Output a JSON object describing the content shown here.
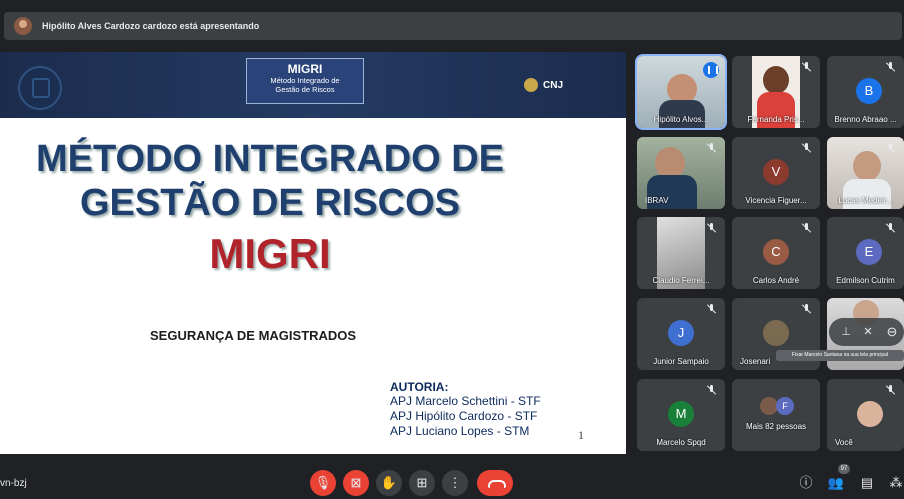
{
  "presenting_banner": "Hipólito Alves Cardozo cardozo está apresentando",
  "slide": {
    "box_title": "MIGRI",
    "box_subtitle_line1": "Método Integrado de",
    "box_subtitle_line2": "Gestão de Riscos",
    "logo_text": "CNJ",
    "title_line1": "MÉTODO INTEGRADO DE",
    "title_line2": "GESTÃO DE RISCOS",
    "title_line3": "MIGRI",
    "subtitle": "SEGURANÇA DE MAGISTRADOS",
    "autoria_label": "AUTORIA:",
    "authors": [
      "APJ Marcelo Schettini - STF",
      "APJ Hipólito Cardozo - STF",
      "APJ Luciano Lopes - STM"
    ],
    "page_number": "1"
  },
  "participants": [
    {
      "name": "Hipólito Alvos...",
      "type": "video",
      "speaking": true
    },
    {
      "name": "Fernanda Pris...",
      "type": "video"
    },
    {
      "name": "Brenno Abraao ...",
      "type": "avatar",
      "initial": "B",
      "color": "#1a73e8"
    },
    {
      "name": "IBRAV",
      "type": "video"
    },
    {
      "name": "Vicencia Figuer...",
      "type": "avatar",
      "initial": "V",
      "color": "#8b3a2e"
    },
    {
      "name": "Lucas Medeir...",
      "type": "video"
    },
    {
      "name": "Claudio Ferrei...",
      "type": "video"
    },
    {
      "name": "Carlos André",
      "type": "avatar",
      "initial": "C",
      "color": "#9a5b44"
    },
    {
      "name": "Edmilson Cutrim",
      "type": "avatar",
      "initial": "E",
      "color": "#5c6bc0"
    },
    {
      "name": "Junior Sampaio",
      "type": "avatar",
      "initial": "J",
      "color": "#3f6fd1"
    },
    {
      "name": "Josenari",
      "type": "video"
    },
    {
      "name": "Marcelo Santana",
      "type": "video"
    },
    {
      "name": "Marcelo Spqd",
      "type": "avatar",
      "initial": "M",
      "color": "#188038"
    },
    {
      "name": "Mais 82 pessoas",
      "type": "more",
      "initial": "F"
    },
    {
      "name": "Você",
      "type": "video"
    }
  ],
  "tooltip": "Fixar Marcelo Santana na sua tela principal",
  "meeting_code": "vn-bzj",
  "participant_count": "97",
  "icons": {
    "mic_off": "mic-off-icon",
    "cam_off": "camera-off-icon",
    "raise_hand": "hand-icon",
    "present": "present-icon",
    "more": "more-vert-icon",
    "end_call": "end-call-icon",
    "info": "info-icon",
    "people": "people-icon",
    "chat": "chat-icon",
    "activities": "activities-icon"
  },
  "colors": {
    "end_call": "#ea4335",
    "accent": "#8ab4f8",
    "background": "#202124"
  }
}
